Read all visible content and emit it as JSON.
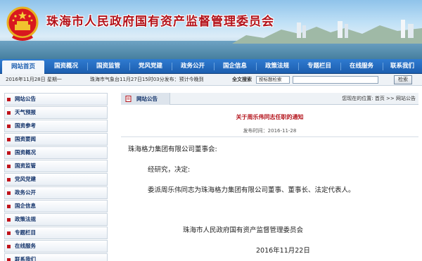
{
  "header": {
    "title": "珠海市人民政府国有资产监督管理委员会"
  },
  "nav": {
    "items": [
      "网站首页",
      "国资概况",
      "国资监管",
      "党风党建",
      "政务公开",
      "国企信息",
      "政策法规",
      "专题栏目",
      "在线服务",
      "联系我们"
    ],
    "active_index": 0
  },
  "infobar": {
    "date": "2016年11月28日 星期一",
    "weather": "珠海市气象台11月27日15时03分发布：预计今晚到",
    "search_label": "全文搜索",
    "search_scope": "按标题检索",
    "search_button": "检索"
  },
  "sidebar": {
    "items": [
      "网站公告",
      "天气预报",
      "国资参考",
      "国资要闻",
      "国资概况",
      "国资监管",
      "党风党建",
      "政务公开",
      "国企信息",
      "政策法规",
      "专题栏目",
      "在线服务",
      "联系我们"
    ]
  },
  "main": {
    "tab_label": "网站公告",
    "breadcrumb": "您现在的位置: 首页 >> 网站公告",
    "notice_title": "关于周乐伟同志任职的通知",
    "meta": "发布时间：2016-11-28",
    "addressee": "珠海格力集团有限公司董事会:",
    "line1": "经研究，决定:",
    "line2": "委派周乐伟同志为珠海格力集团有限公司董事、董事长、法定代表人。",
    "signature": "珠海市人民政府国有资产监督管理委员会",
    "sign_date": "2016年11月22日"
  },
  "colors": {
    "brand_red": "#b3121a",
    "nav_blue": "#1c5eaf"
  }
}
